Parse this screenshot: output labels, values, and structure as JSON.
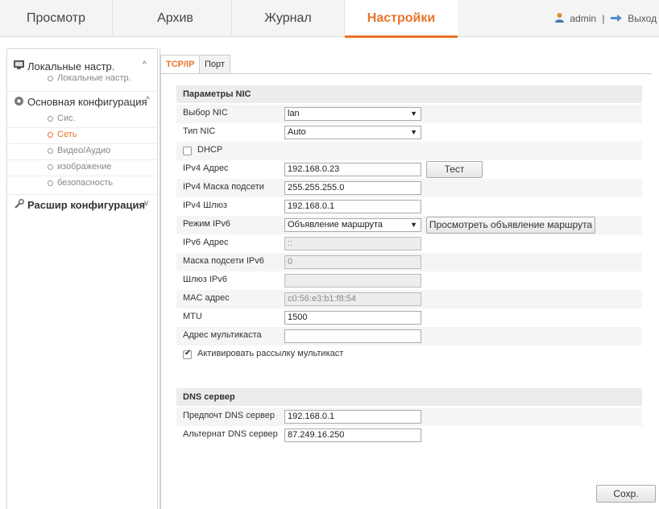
{
  "topnav": {
    "tabs": [
      "Просмотр",
      "Архив",
      "Журнал",
      "Настройки"
    ],
    "active_tab": "Настройки",
    "user": "admin",
    "separator": "|",
    "logout": "Выход"
  },
  "sidebar": {
    "local": {
      "label": "Локальные настр.",
      "chevron": "^",
      "items": [
        "Локальные настр."
      ]
    },
    "basic": {
      "label": "Основная конфигурация",
      "chevron": "^",
      "items": [
        "Сис.",
        "Сеть",
        "Видео/Аудио",
        "изображение",
        "безопасность"
      ],
      "active_item": "Сеть"
    },
    "advanced": {
      "label": "Расшир конфигурация",
      "chevron": "v"
    }
  },
  "subtabs": [
    "TCP/IP",
    "Порт"
  ],
  "nic": {
    "section_title": "Параметры NIC",
    "nic_select": {
      "label": "Выбор NIC",
      "value": "lan"
    },
    "nic_type": {
      "label": "Тип NIC",
      "value": "Auto"
    },
    "dhcp": {
      "label": "DHCP",
      "checked": false
    },
    "ipv4_address": {
      "label": "IPv4 Адрес",
      "value": "192.168.0.23",
      "test_button": "Тест"
    },
    "ipv4_mask": {
      "label": "IPv4 Маска подсети",
      "value": "255.255.255.0"
    },
    "ipv4_gateway": {
      "label": "IPv4 Шлюз",
      "value": "192.168.0.1"
    },
    "ipv6_mode": {
      "label": "Режим IPv6",
      "value": "Объявление маршрута",
      "view_button": "Просмотреть объявление маршрута"
    },
    "ipv6_address": {
      "label": "IPv6 Адрес",
      "value": "::"
    },
    "ipv6_mask": {
      "label": "Маска подсети IPv6",
      "value": "0"
    },
    "ipv6_gateway": {
      "label": "Шлюз IPv6",
      "value": ""
    },
    "mac": {
      "label": "MAC адрес",
      "value": "c0:56:e3:b1:f8:54"
    },
    "mtu": {
      "label": "MTU",
      "value": "1500"
    },
    "multicast": {
      "label": "Адрес мультикаста",
      "value": ""
    },
    "multicast_enable": {
      "label": "Активировать рассылку мультикаст",
      "checked": true
    }
  },
  "dns": {
    "section_title": "DNS сервер",
    "preferred": {
      "label": "Предпочт DNS сервер",
      "value": "192.168.0.1"
    },
    "alternate": {
      "label": "Альтернат DNS сервер",
      "value": "87.249.16.250"
    }
  },
  "save_label": "Сохр.",
  "colors": {
    "accent": "#e8742a",
    "header_bg": "#f4f4f4",
    "section_bg": "#ececec"
  },
  "icons": {
    "user": "user-icon",
    "logout": "logout-icon",
    "local": "monitor-icon",
    "basic": "gear-icon",
    "advanced": "wrench-icon"
  }
}
